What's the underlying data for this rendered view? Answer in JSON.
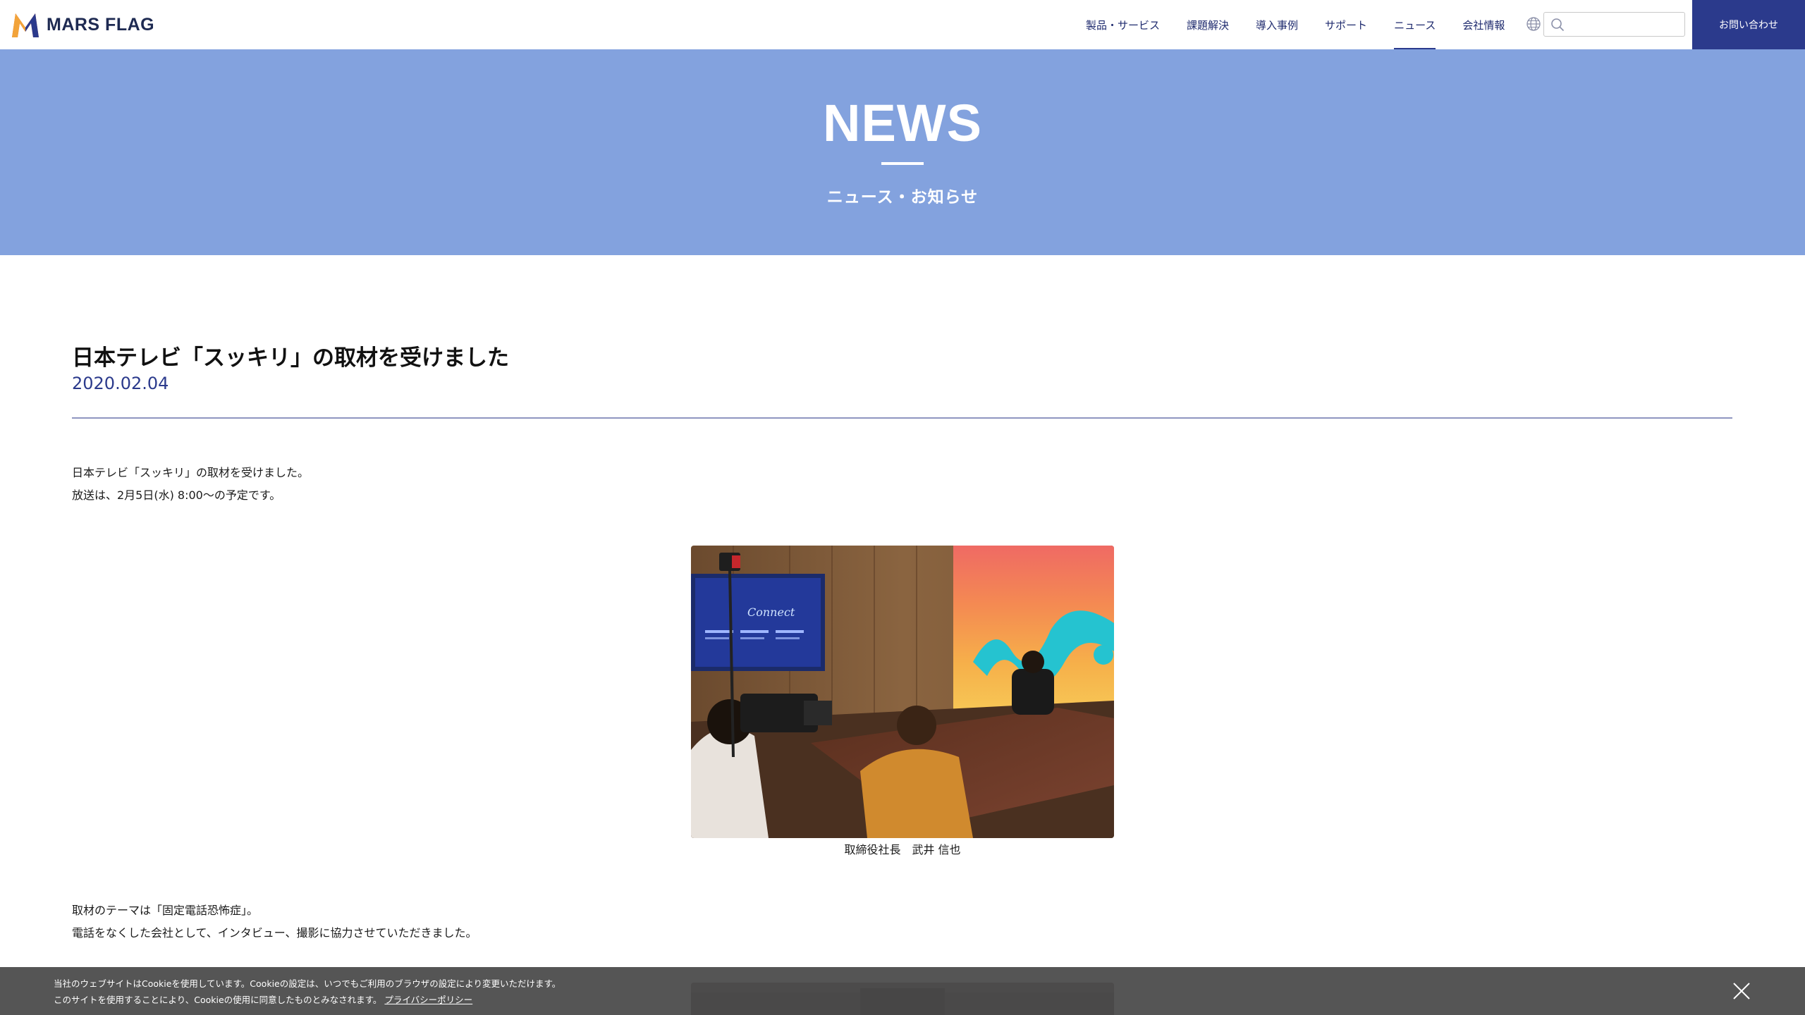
{
  "header": {
    "logo_text": "MARS FLAG",
    "nav": [
      {
        "label": "製品・サービス"
      },
      {
        "label": "課題解決"
      },
      {
        "label": "導入事例"
      },
      {
        "label": "サポート"
      },
      {
        "label": "ニュース",
        "active": true
      },
      {
        "label": "会社情報"
      }
    ],
    "search_value": "",
    "contact_label": "お問い合わせ",
    "brand_color": "#2b3a8c"
  },
  "hero": {
    "title": "NEWS",
    "subtitle": "ニュース・お知らせ",
    "background": "#83a2de"
  },
  "article": {
    "title": "日本テレビ「スッキリ」の取材を受けました",
    "date": "2020.02.04",
    "intro": [
      "日本テレビ「スッキリ」の取材を受けました。",
      "放送は、2月5日(水) 8:00〜の予定です。"
    ],
    "photo_caption": "取締役社長　武井 信也",
    "body": [
      "取材のテーマは「固定電話恐怖症」。",
      "電話をなくした会社として、インタビュー、撮影に協力させていただきました。"
    ]
  },
  "cookie": {
    "line1": "当社のウェブサイトはCookieを使用しています。Cookieの設定は、いつでもご利用のブラウザの設定により変更いただけます。",
    "line2": "このサイトを使用することにより、Cookieの使用に同意したものとみなされます。",
    "policy_link": "プライバシーポリシー"
  }
}
